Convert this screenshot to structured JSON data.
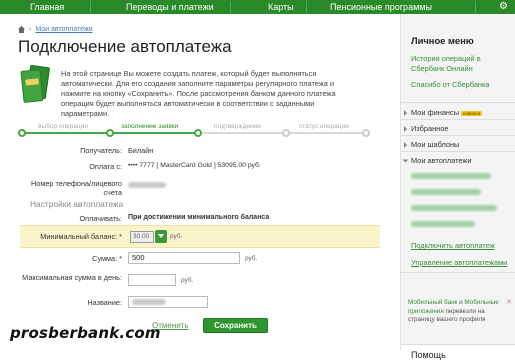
{
  "topnav": {
    "items": [
      "Главная",
      "Переводы и платежи",
      "Карты",
      "Пенсионные программы"
    ],
    "settings_icon": "gear-icon"
  },
  "breadcrumb": {
    "link": "Мои автоплатежи"
  },
  "page_title": "Подключение автоплатежа",
  "intro": "На этой странице Вы можете создать платеж, который будет выполняться автоматически. Для его создания заполните параметры регулярного платежа и нажмите на кнопку «Сохранить». После рассмотрения банком данного платежа операция будет выполняться автоматически в соответствии с заданными параметрами.",
  "steps": [
    {
      "label": "выбор операции",
      "state": "done"
    },
    {
      "label": "заполнение заявки",
      "state": "active"
    },
    {
      "label": "подтверждение",
      "state": "pending"
    },
    {
      "label": "статус операции",
      "state": "pending"
    }
  ],
  "form": {
    "recipient_label": "Получатель:",
    "recipient_value": "Билайн",
    "pay_from_label": "Оплата с:",
    "pay_from_value": "•••• 7777  [ MasterCard Gold ]  53095.00  руб.",
    "phone_label": "Номер телефона/лицевого счета",
    "section_title": "Настройки автоплатежа",
    "pay_label": "Оплачивать:",
    "pay_value": "При достижении минимального баланса",
    "min_balance_label": "Минимальный баланс: *",
    "min_balance_value": "30.00",
    "min_balance_unit": "руб.",
    "amount_label": "Сумма: *",
    "amount_value": "500",
    "amount_unit": "руб.",
    "max_amount_label": "Максимальная сумма в день:",
    "max_amount_unit": "руб.",
    "name_label": "Название:",
    "cancel_label": "Отменить",
    "save_label": "Сохранить"
  },
  "sidebar": {
    "title": "Личное меню",
    "links": [
      "История операций в Сбербанк Онлайн",
      "Спасибо от Сбербанка"
    ],
    "menu": [
      {
        "label": "Мои финансы",
        "badge": "новинка"
      },
      {
        "label": "Избранное"
      },
      {
        "label": "Мои шаблоны"
      },
      {
        "label": "Мои автоплатежи"
      }
    ],
    "connect_link": "Подключить автоплатеж",
    "manage_link": "Управление автоплатежами",
    "ad_text_a": "Мобильный банк",
    "ad_text_b": " и ",
    "ad_text_c": "Мобильные приложения",
    "ad_text_d": " перевезли на страницу вашего профиля",
    "help": "Помощь"
  },
  "watermark": "prosberbank.com",
  "colors": {
    "brand_green": "#2a8a2a",
    "highlight": "#fbf3c9",
    "badge": "#f2c21c"
  }
}
